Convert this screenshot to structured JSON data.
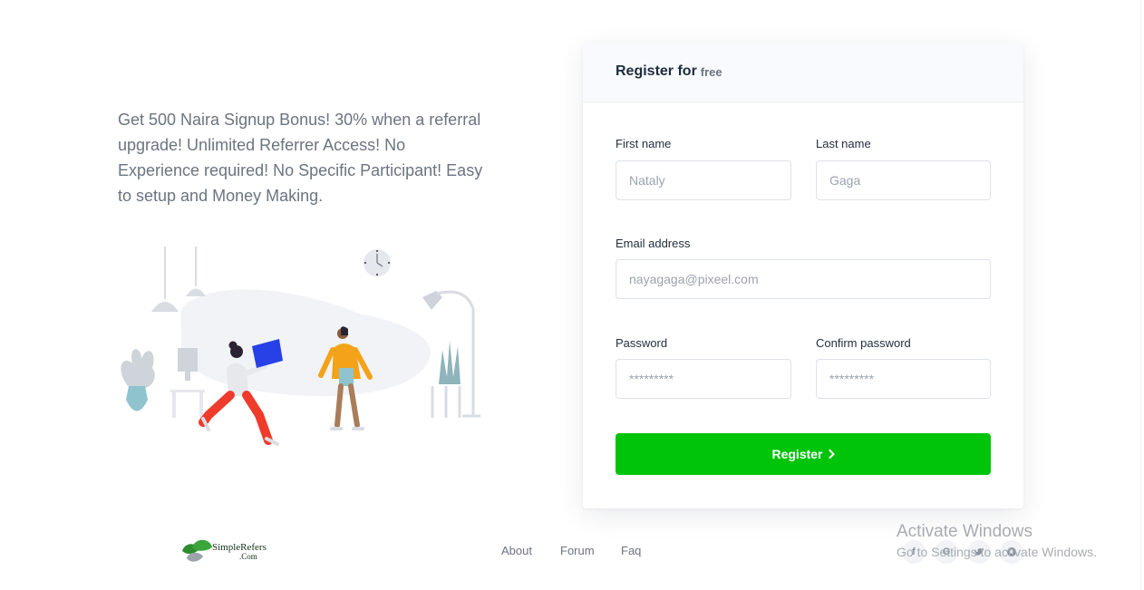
{
  "promo": {
    "text": "Get 500 Naira Signup Bonus! 30% when a referral upgrade! Unlimited Referrer Access! No Experience required! No Specific Participant! Easy to setup and Money Making."
  },
  "form": {
    "title": "Register for",
    "title_em": "free",
    "first_name": {
      "label": "First name",
      "placeholder": "Nataly"
    },
    "last_name": {
      "label": "Last name",
      "placeholder": "Gaga"
    },
    "email": {
      "label": "Email address",
      "placeholder": "nayagaga@pixeel.com"
    },
    "password": {
      "label": "Password",
      "placeholder": "*********"
    },
    "confirm_password": {
      "label": "Confirm password",
      "placeholder": "*********"
    },
    "submit_label": "Register",
    "submit_icon": "chevron-right-icon"
  },
  "footer": {
    "logo_text": "SimpleRefers",
    "logo_subtext": ".Com",
    "links": [
      "About",
      "Forum",
      "Faq"
    ],
    "social_icons": [
      "facebook-icon",
      "google-icon",
      "twitter-icon",
      "github-icon"
    ]
  },
  "watermark": {
    "title": "Activate Windows",
    "subtitle": "Go to Settings to activate Windows."
  },
  "colors": {
    "primary_button": "#00c40a",
    "card_header_bg": "#f8fafd",
    "text_muted": "#6b7480",
    "illustration_accent_blue": "#2741e6",
    "illustration_accent_red": "#ef3b2c",
    "illustration_accent_orange": "#f3a21a"
  }
}
